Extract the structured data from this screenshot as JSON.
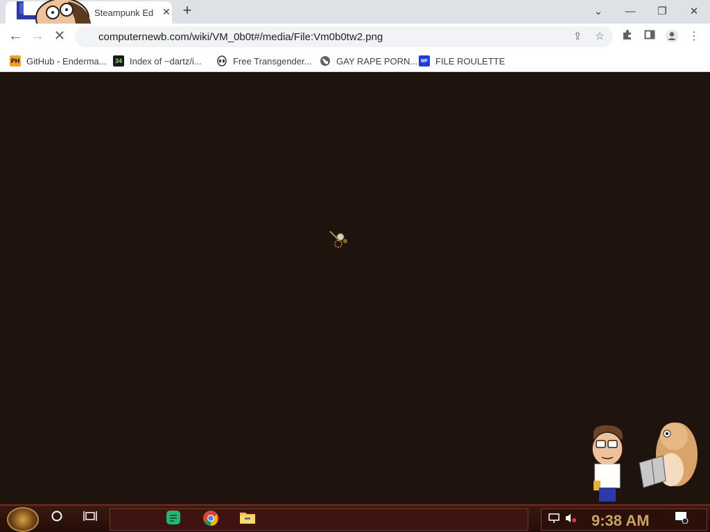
{
  "browser": {
    "tab": {
      "title": "Steampunk Edition"
    },
    "window_controls": {
      "collapse": "⌄",
      "minimize": "—",
      "restore": "❐",
      "close": "✕"
    },
    "address": {
      "url": "computernewb.com/wiki/VM_0b0t#/media/File:Vm0b0tw2.png"
    },
    "bookmarks": [
      {
        "label": "GitHub - Enderma...",
        "favicon": "PH",
        "color": "#f7a21b",
        "text_color": "#000000"
      },
      {
        "label": "Index of ~dartz/i...",
        "favicon": "34",
        "color": "#1a1a1a",
        "text_color": "#8fdf6f"
      },
      {
        "label": "Free Transgender...",
        "favicon": "alien",
        "color": "#ffffff",
        "text_color": "#333333"
      },
      {
        "label": "GAY RAPE PORN...",
        "favicon": "globe",
        "color": "#ffffff",
        "text_color": "#5f6368"
      },
      {
        "label": "FILE ROULETTE",
        "favicon": "MF",
        "color": "#1a3fd9",
        "text_color": "#ffffff"
      }
    ]
  },
  "page": {
    "background": "#1f140d"
  },
  "taskbar": {
    "clock": "9:38 AM",
    "notification_count": "1",
    "accent": "#c9a45a"
  }
}
